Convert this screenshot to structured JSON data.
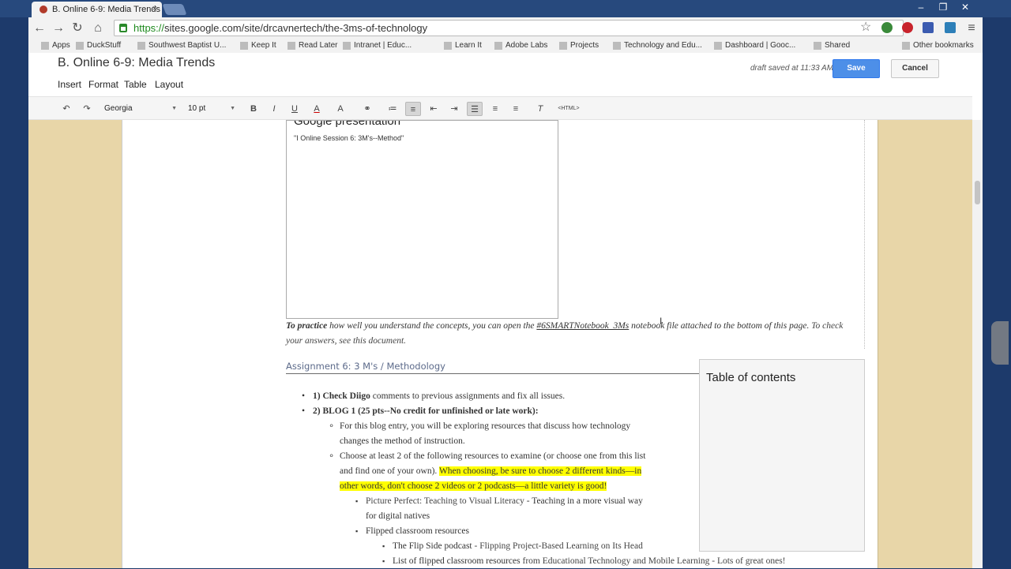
{
  "tab": {
    "title": "B. Online 6-9: Media Trends",
    "close": "×"
  },
  "window_controls": {
    "minimize": "–",
    "maximize": "❐",
    "close": "✕"
  },
  "address": {
    "scheme": "https://",
    "rest": "sites.google.com/site/drcavnertech/the-3ms-of-technology"
  },
  "bookmarks": [
    "Apps",
    "DuckStuff",
    "Southwest Baptist U...",
    "Keep It",
    "Read Later",
    "Intranet | Educ...",
    "Learn It",
    "Adobe Labs",
    "Projects",
    "Technology and Edu...",
    "Dashboard | Gooc...",
    "Shared",
    "Other bookmarks"
  ],
  "editor": {
    "site_title": "B. Online 6-9: Media Trends",
    "menu": [
      "Insert",
      "Format",
      "Table",
      "Layout"
    ],
    "draft_status": "draft saved at 11:33 AM",
    "save_label": "Save",
    "cancel_label": "Cancel",
    "font_family": "Georgia",
    "font_size": "10 pt",
    "html_label": "<HTML>"
  },
  "content": {
    "gadget_title": "Google presentation",
    "gadget_subtitle": "\"I Online Session 6: 3M's--Method\"",
    "para_lead": "To practice",
    "para_mid": " how well you understand the concepts, you can open the ",
    "para_link1": "#6SMARTNotebook_3Ms",
    "para_after": " notebook file attached to the bottom of this page.",
    "para_check": " To check your answers, see this document.",
    "section_heading": "Assignment 6: 3 M's / Methodology",
    "toc_title": "Table of contents",
    "items": [
      {
        "kind": "bullet",
        "bold": "1) Check Diigo",
        "rest": " comments to previous assignments and fix all issues."
      },
      {
        "kind": "bullet",
        "bold": "2) BLOG 1 (25 pts--No credit for unfinished or late work):",
        "rest": ""
      },
      {
        "kind": "circle",
        "text": "For this blog entry, you will be exploring resources that discuss how technology"
      },
      {
        "kind": "cont2",
        "text": "changes the method of instruction."
      },
      {
        "kind": "circle",
        "text": "Choose at least 2 of the following resources to examine (or choose one from this list"
      },
      {
        "kind": "cont2",
        "pre": "and find one of your own).  ",
        "hl": "When choosing, be sure to choose 2 different kinds—in"
      },
      {
        "kind": "cont2",
        "hl": "other words, don't choose 2 videos or 2 podcasts—a little variety is good!"
      },
      {
        "kind": "square",
        "link": "Picture Perfect: Teaching to Visual Literacy",
        "rest": " - Teaching in a more visual way"
      },
      {
        "kind": "cont3",
        "text": "for digital natives"
      },
      {
        "kind": "square",
        "text": "Flipped classroom resources"
      },
      {
        "kind": "square4",
        "pre": "The Flip Side podcast",
        "link": " - Flipping Project-Based Learning on Its Head"
      },
      {
        "kind": "square4",
        "pre": "List of flipped classroom resources",
        "link": " from Educational Technology and Mobile Learning - Lots of great ones!"
      }
    ]
  },
  "colors": {
    "save": "#4d8fe8",
    "highlight": "#ffff00",
    "tab_bar": "#27497d",
    "page_bg": "#d9c9a0"
  }
}
